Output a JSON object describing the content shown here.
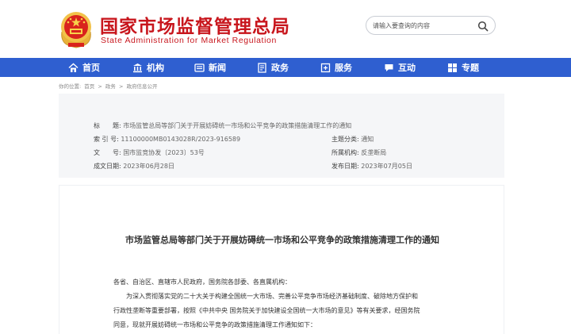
{
  "header": {
    "title_cn": "国家市场监督管理总局",
    "title_en": "State Administration for Market Regulation",
    "search_placeholder": "请输入要查询的内容",
    "emblem_icon": "national-emblem-icon",
    "search_icon": "search-icon"
  },
  "nav": {
    "items": [
      {
        "label": "首页",
        "icon": "home-icon"
      },
      {
        "label": "机构",
        "icon": "institution-icon"
      },
      {
        "label": "新闻",
        "icon": "news-icon"
      },
      {
        "label": "政务",
        "icon": "government-affairs-icon"
      },
      {
        "label": "服务",
        "icon": "service-icon"
      },
      {
        "label": "互动",
        "icon": "interaction-icon"
      },
      {
        "label": "专题",
        "icon": "topics-icon"
      }
    ]
  },
  "breadcrumb": {
    "prefix": "你的位置:",
    "items": [
      "首页",
      "政务",
      "政府信息公开"
    ],
    "separator": ">"
  },
  "meta": {
    "title_key": "标　　题:",
    "title_val": "市场监管总局等部门关于开展妨碍统一市场和公平竞争的政策措施清理工作的通知",
    "index_key": "索 引 号:",
    "index_val": "11100000MB0143028R/2023-916589",
    "category_key": "主题分类:",
    "category_val": "通知",
    "docno_key": "文　　号:",
    "docno_val": "国市监竞协发〔2023〕53号",
    "org_key": "所属机构:",
    "org_val": "反垄断局",
    "written_key": "成文日期:",
    "written_val": "2023年06月28日",
    "published_key": "发布日期:",
    "published_val": "2023年07月05日"
  },
  "article": {
    "title": "市场监管总局等部门关于开展妨碍统一市场和公平竞争的政策措施清理工作的通知",
    "salutation": "各省、自治区、直辖市人民政府，国务院各部委、各直属机构：",
    "line1": "为深入贯彻落实党的二十大关于构建全国统一大市场、完善公平竞争市场经济基础制度、破除地方保护和",
    "line2": "行政性垄断等重要部署，按照《中共中央 国务院关于加快建设全国统一大市场的意见》等有关要求，经国务院",
    "line3": "同意，现就开展妨碍统一市场和公平竞争的政策措施清理工作通知如下："
  },
  "colors": {
    "brand_red": "#c8161d",
    "nav_blue": "#2f5fd0",
    "meta_bg": "#f5f6f8"
  }
}
